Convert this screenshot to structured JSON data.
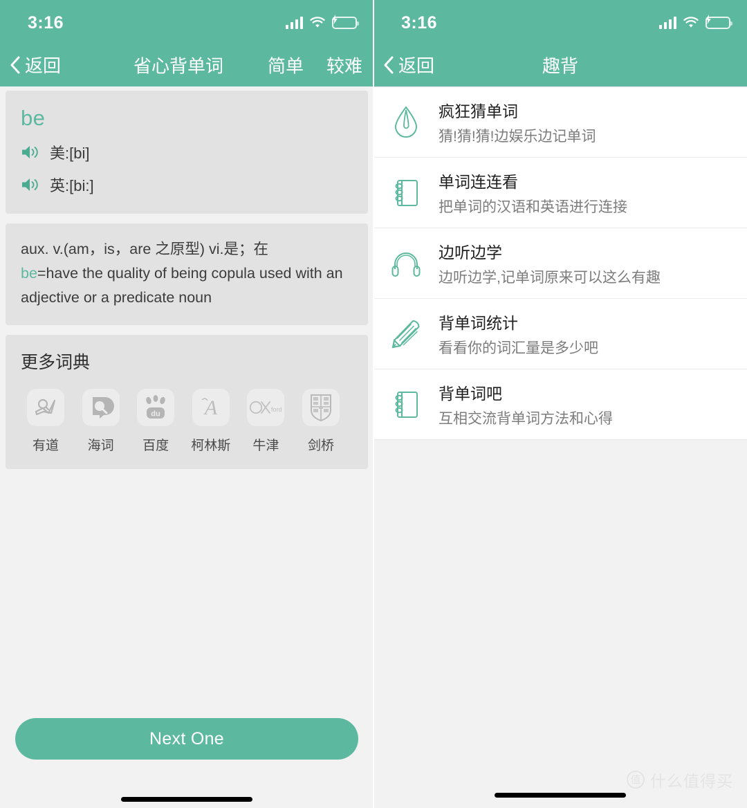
{
  "status_bar": {
    "time": "3:16",
    "signal_icon": "cellular-signal-icon",
    "wifi_icon": "wifi-icon",
    "battery_icon": "battery-charging-icon"
  },
  "theme": {
    "accent": "#5cb99f",
    "card_bg": "#e2e2e2",
    "page_bg": "#f2f2f2",
    "battery_green": "#4cd964"
  },
  "left_screen": {
    "nav": {
      "back_label": "返回",
      "title": "省心背单词",
      "actions": [
        {
          "label": "简单"
        },
        {
          "label": "较难"
        }
      ]
    },
    "word_card": {
      "word": "be",
      "pronunciations": [
        {
          "label": "美:[bi]"
        },
        {
          "label": "英:[bi:]"
        }
      ]
    },
    "definition_card": {
      "line1": "aux. v.(am，is，are 之原型) vi.是；在",
      "highlight": "be",
      "line2_rest": "=have the quality of being copula used with an adjective or a predicate noun"
    },
    "dictionary_section": {
      "title": "更多词典",
      "items": [
        {
          "label": "有道",
          "icon": "youdao-dictionary-icon"
        },
        {
          "label": "海词",
          "icon": "dict-cn-dictionary-icon"
        },
        {
          "label": "百度",
          "icon": "baidu-dictionary-icon"
        },
        {
          "label": "柯林斯",
          "icon": "collins-dictionary-icon"
        },
        {
          "label": "牛津",
          "icon": "oxford-dictionary-icon"
        },
        {
          "label": "剑桥",
          "icon": "cambridge-dictionary-icon"
        }
      ]
    },
    "next_button": "Next One"
  },
  "right_screen": {
    "nav": {
      "back_label": "返回",
      "title": "趣背"
    },
    "items": [
      {
        "title": "疯狂猜单词",
        "subtitle": "猜!猜!猜!边娱乐边记单词",
        "icon": "water-drop-icon"
      },
      {
        "title": "单词连连看",
        "subtitle": "把单词的汉语和英语进行连接",
        "icon": "notebook-icon"
      },
      {
        "title": "边听边学",
        "subtitle": "边听边学,记单词原来可以这么有趣",
        "icon": "headphones-icon"
      },
      {
        "title": "背单词统计",
        "subtitle": "看看你的词汇量是多少吧",
        "icon": "pencil-icon"
      },
      {
        "title": "背单词吧",
        "subtitle": "互相交流背单词方法和心得",
        "icon": "notebook-icon"
      }
    ],
    "watermark": {
      "badge": "值",
      "text": "什么值得买"
    }
  }
}
